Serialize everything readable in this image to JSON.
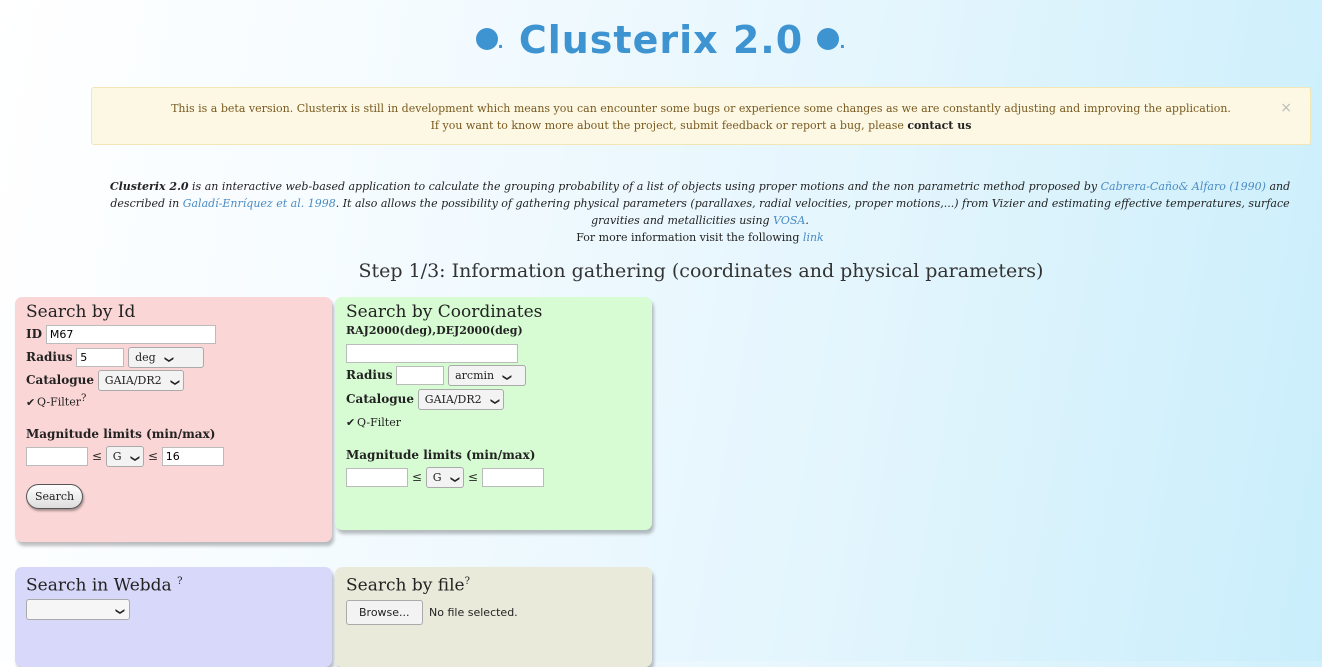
{
  "app": {
    "logo_title": "Clusterix 2.0",
    "accent_color": "#3e94d1"
  },
  "alert": {
    "line1": "This is a beta version. Clusterix is still in development which means you can encounter some bugs or experience some changes as we are constantly adjusting and improving the application.",
    "line2_prefix": "If you want to know more about the project, submit feedback or report a bug, please",
    "contact_link": "contact us",
    "close": "×"
  },
  "intro": {
    "app_name": "Clusterix 2.0",
    "text1": " is an interactive web-based application to calculate the grouping probability of a list of objects using proper motions and the non parametric method proposed by ",
    "link1": "Cabrera-Caño& Alfaro (1990)",
    "text2": " and described in ",
    "link2": "Galadí-Enríquez et al. 1998",
    "text3": ". It also allows the possibility of gathering physical parameters (parallaxes, radial velocities, proper motions,...) from Vizier and estimating effective temperatures, surface gravities and metallicities using ",
    "link3": "VOSA",
    "text4": ".",
    "more_prefix": "For more information visit the following",
    "more_link": "link"
  },
  "step_title": "Step 1/3: Information gathering (coordinates and physical parameters)",
  "search_by_id": {
    "title": "Search by Id",
    "id_label": "ID",
    "id_value": "M67",
    "radius_label": "Radius",
    "radius_value": "5",
    "radius_unit": "deg",
    "catalogue_label": "Catalogue",
    "catalogue_value": "GAIA/DR2",
    "qfilter_label": "Q-Filter",
    "qfilter_sup": "?",
    "qfilter_checked": "✔",
    "mag_label": "Magnitude limits (min/max)",
    "mag_min": "",
    "mag_band": "G",
    "mag_max": "16",
    "leq": "≤",
    "search_button": "Search"
  },
  "search_by_coords": {
    "title": "Search by Coordinates",
    "coord_label": "RAJ2000(deg),DEJ2000(deg)",
    "coord_value": "",
    "radius_label": "Radius",
    "radius_value": "",
    "radius_unit": "arcmin",
    "catalogue_label": "Catalogue",
    "catalogue_value": "GAIA/DR2",
    "qfilter_label": "Q-Filter",
    "qfilter_checked": "✔",
    "mag_label": "Magnitude limits (min/max)",
    "mag_min": "",
    "mag_band": "G",
    "mag_max": "",
    "leq": "≤"
  },
  "search_webda": {
    "title": "Search in Webda",
    "sup": "?",
    "select_value": ""
  },
  "search_file": {
    "title": "Search by file",
    "sup": "?",
    "browse_button": "Browse...",
    "file_status": "No file selected."
  }
}
